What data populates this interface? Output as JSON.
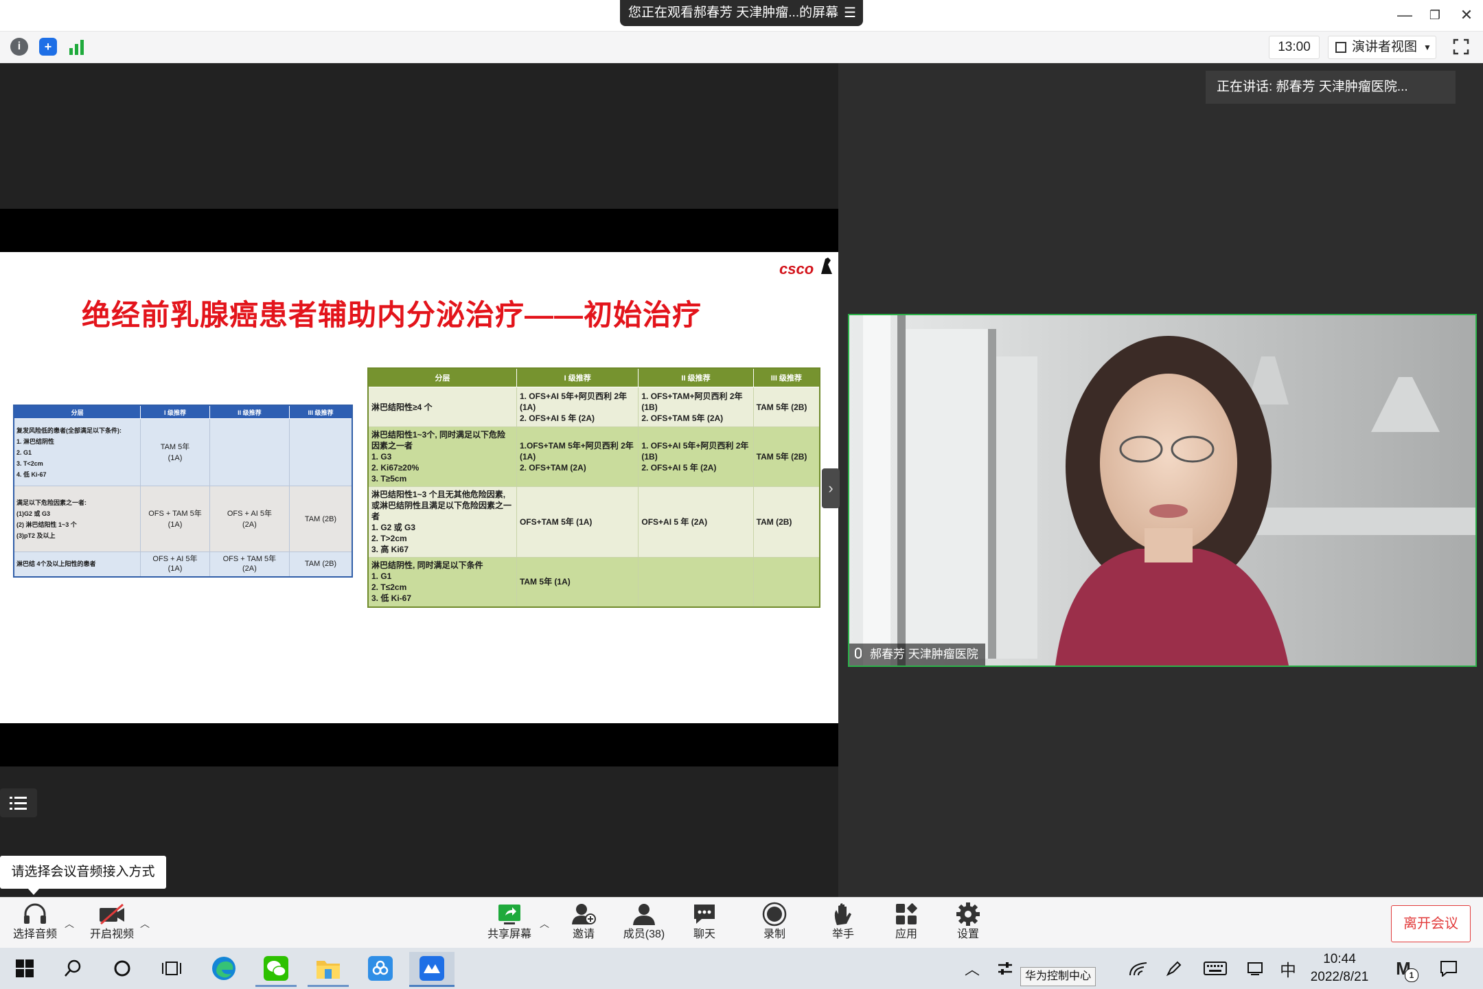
{
  "titlebar": {
    "share_banner": "您正在观看郝春芳 天津肿瘤...的屏幕"
  },
  "toolbar": {
    "timer": "13:00",
    "view_label": "演讲者视图"
  },
  "speaker": {
    "active_label": "正在讲话: 郝春芳 天津肿瘤医院...",
    "video_name": "郝春芳 天津肿瘤医院"
  },
  "slide": {
    "logo": "csco",
    "title": "绝经前乳腺癌患者辅助内分泌治疗——初始治疗",
    "left_table": {
      "headers": [
        "分层",
        "I 级推荐",
        "II 级推荐",
        "III 级推荐"
      ],
      "rows": [
        [
          "复发风险低的患者(全部满足以下条件):\n1. 淋巴结阴性\n2. G1\n3. T<2cm\n4. 低 Ki-67",
          "TAM 5年\n(1A)",
          "",
          ""
        ],
        [
          "满足以下危险因素之一者:\n(1)G2 或 G3\n(2) 淋巴结阳性 1~3 个\n(3)pT2 及以上",
          "OFS + TAM 5年\n(1A)",
          "OFS + AI 5年\n(2A)",
          "TAM (2B)"
        ],
        [
          "淋巴结 4个及以上阳性的患者",
          "OFS + AI 5年\n(1A)",
          "OFS + TAM 5年\n(2A)",
          "TAM (2B)"
        ]
      ]
    },
    "right_table": {
      "headers": [
        "分层",
        "I 级推荐",
        "II 级推荐",
        "III 级推荐"
      ],
      "rows": [
        [
          "淋巴结阳性≥4 个",
          "1. OFS+AI 5年+阿贝西利 2年\n(1A)\n2. OFS+AI 5 年 (2A)",
          "1. OFS+TAM+阿贝西利 2年\n(1B)\n2. OFS+TAM 5年 (2A)",
          "TAM 5年 (2B)"
        ],
        [
          "淋巴结阳性1~3个, 同时满足以下危险因素之一者\n1. G3\n2. Ki67≥20%\n3. T≥5cm",
          "1.OFS+TAM 5年+阿贝西利 2年\n(1A)\n2. OFS+TAM (2A)",
          "1. OFS+AI 5年+阿贝西利 2年\n(1B)\n2. OFS+AI 5 年 (2A)",
          "TAM 5年 (2B)"
        ],
        [
          "淋巴结阳性1~3 个且无其他危险因素, 或淋巴结阴性且满足以下危险因素之一者\n1. G2 或 G3\n2. T>2cm\n3. 高 Ki67",
          "OFS+TAM 5年 (1A)",
          "OFS+AI 5 年 (2A)",
          "TAM (2B)"
        ],
        [
          "淋巴结阴性, 同时满足以下条件\n1. G1\n2. T≤2cm\n3. 低 Ki-67",
          "TAM 5年 (1A)",
          "",
          ""
        ]
      ]
    }
  },
  "audio_tooltip": "请选择会议音频接入方式",
  "meetbar": {
    "audio": "选择音频",
    "video": "开启视频",
    "share": "共享屏幕",
    "invite": "邀请",
    "members": "成员(38)",
    "chat": "聊天",
    "record": "录制",
    "raise_hand": "举手",
    "apps": "应用",
    "settings": "设置",
    "leave": "离开会议"
  },
  "taskbar": {
    "ime": "中",
    "time": "10:44",
    "date": "2022/8/21",
    "tooltip": "华为控制中心",
    "notification_count": "1"
  },
  "colors": {
    "title_red": "#e3141b",
    "left_header_blue": "#2e5fb3",
    "right_header_green": "#76932f",
    "active_speaker_border": "#2cb34a",
    "leave_red": "#e23b3b"
  }
}
